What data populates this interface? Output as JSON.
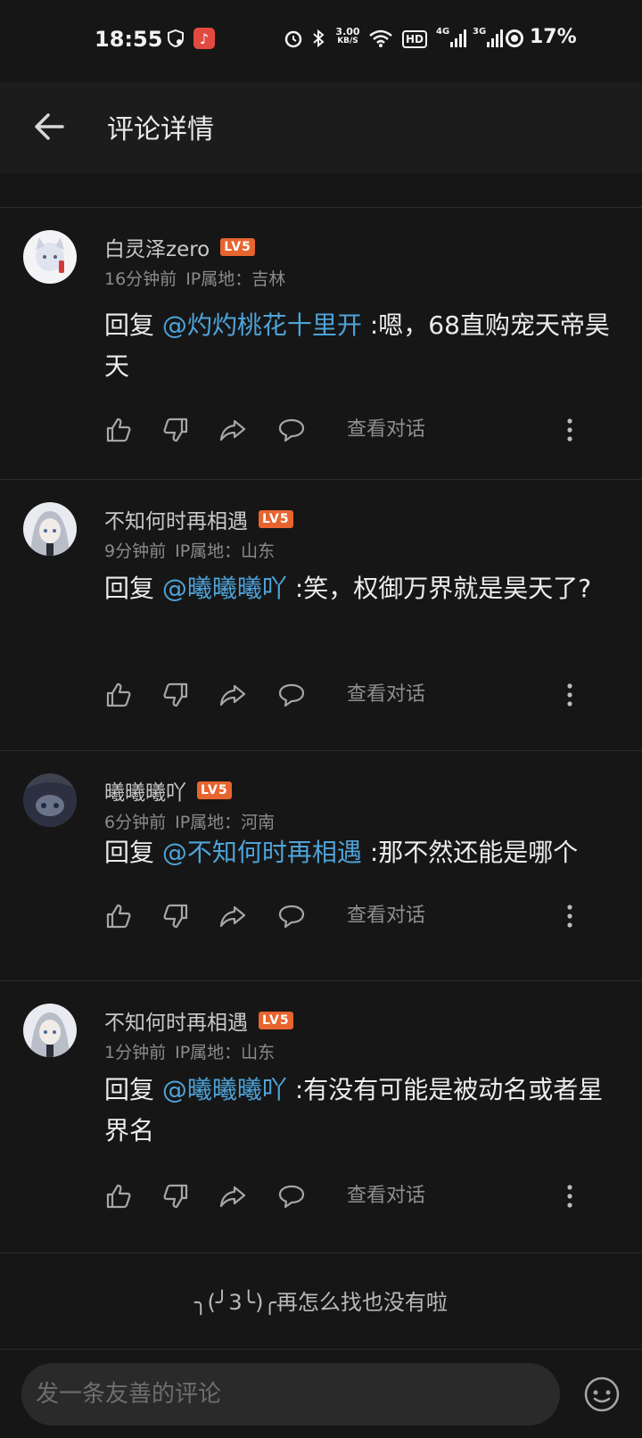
{
  "status_bar": {
    "time": "18:55",
    "net_speed_top": "3.00",
    "net_speed_bottom": "KB/S",
    "hd": "HD",
    "sig1": "4G",
    "sig2": "3G",
    "battery": "17%"
  },
  "header": {
    "title": "评论详情"
  },
  "comments": [
    {
      "user": "白灵泽zero",
      "level": "LV5",
      "time": "16分钟前",
      "ip": "IP属地：吉林",
      "reply_prefix": "回复",
      "mention": "@灼灼桃花十里开",
      "text": ":嗯，68直购宠天帝昊天",
      "view": "查看对话"
    },
    {
      "user": "不知何时再相遇",
      "level": "LV5",
      "time": "9分钟前",
      "ip": "IP属地：山东",
      "reply_prefix": "回复",
      "mention": "@曦曦曦吖",
      "text": ":笑，权御万界就是昊天了?",
      "view": "查看对话"
    },
    {
      "user": "曦曦曦吖",
      "level": "LV5",
      "time": "6分钟前",
      "ip": "IP属地：河南",
      "reply_prefix": "回复",
      "mention": "@不知何时再相遇",
      "text": ":那不然还能是哪个",
      "view": "查看对话"
    },
    {
      "user": "不知何时再相遇",
      "level": "LV5",
      "time": "1分钟前",
      "ip": "IP属地：山东",
      "reply_prefix": "回复",
      "mention": "@曦曦曦吖",
      "text": ":有没有可能是被动名或者星界名",
      "view": "查看对话"
    }
  ],
  "end_text": "╮(╯3╰)╭再怎么找也没有啦",
  "input": {
    "placeholder": "发一条友善的评论"
  },
  "icons": [
    "back-arrow-icon",
    "like-icon",
    "dislike-icon",
    "share-icon",
    "comment-icon",
    "more-icon",
    "emoji-icon",
    "alarm-icon",
    "bluetooth-icon",
    "wifi-icon",
    "music-icon"
  ],
  "colors": {
    "background": "#161616",
    "mention": "#4ea3d8",
    "level_badge": "#e8642f"
  }
}
